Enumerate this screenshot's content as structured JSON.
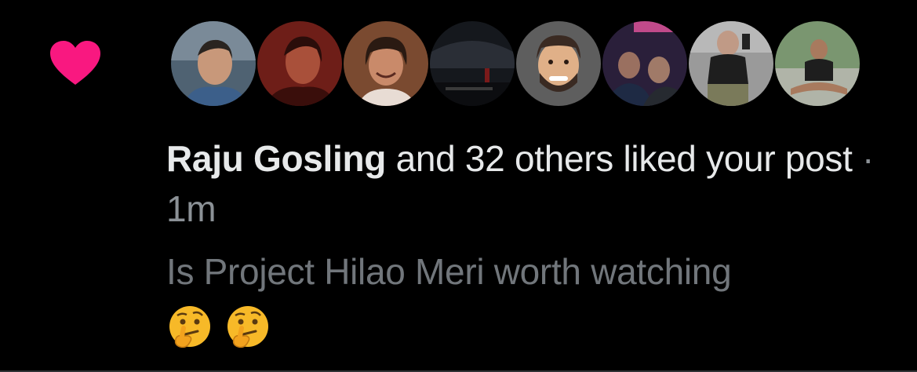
{
  "notification": {
    "actor_name": "Raju Gosling",
    "action_text": " and 32 others liked your post",
    "separator": " · ",
    "timestamp": "1m",
    "post_text": "Is Project Hilao Meri worth watching",
    "emojis": [
      "thinking-face-icon",
      "thinking-face-icon"
    ]
  },
  "avatars": [
    {
      "name": "avatar-1",
      "bg": "#5a6d80",
      "skin": "#c89a7a"
    },
    {
      "name": "avatar-2",
      "bg": "#7a1f1a",
      "skin": "#b35a40"
    },
    {
      "name": "avatar-3",
      "bg": "#8a5a3a",
      "skin": "#c98a6a"
    },
    {
      "name": "avatar-4",
      "bg": "#1a1d24",
      "skin": "#3a3f48"
    },
    {
      "name": "avatar-5",
      "bg": "#6b6b6b",
      "skin": "#e2b48c"
    },
    {
      "name": "avatar-6",
      "bg": "#3a2a4a",
      "skin": "#a07a68"
    },
    {
      "name": "avatar-7",
      "bg": "#8a8a8a",
      "skin": "#c9a08a"
    },
    {
      "name": "avatar-8",
      "bg": "#6f8a5a",
      "skin": "#b08064"
    }
  ],
  "colors": {
    "heart": "#f91880",
    "background": "#000000",
    "primary_text": "#e7e9ea",
    "secondary_text": "#71767b"
  }
}
